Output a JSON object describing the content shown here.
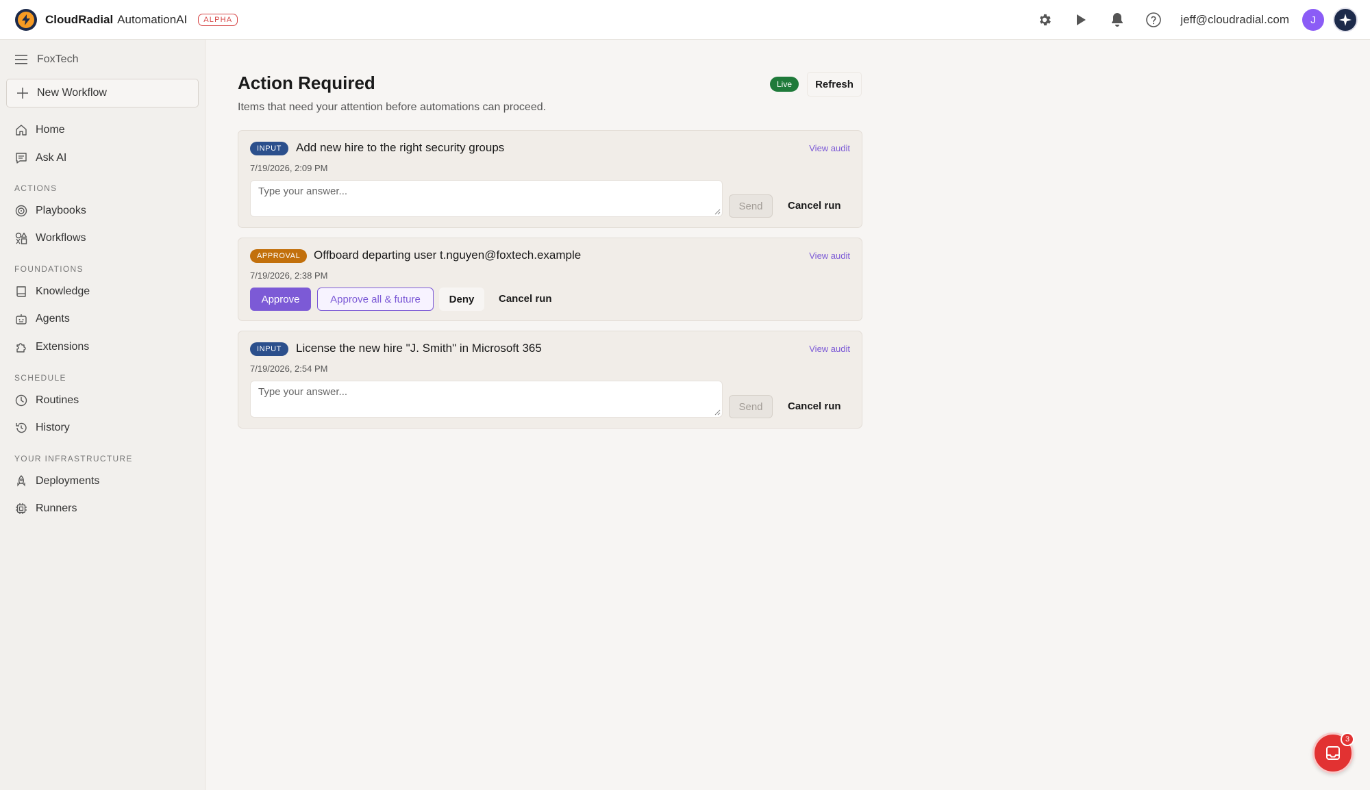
{
  "app": {
    "brand_name": "CloudRadial",
    "product_name": "AutomationAI",
    "stage_badge": "ALPHA"
  },
  "header": {
    "icons": [
      "gear-icon",
      "play-icon",
      "bell-icon",
      "help-icon"
    ],
    "user_email": "jeff@cloudradial.com",
    "avatar_initial": "J"
  },
  "sidebar": {
    "org_name": "FoxTech",
    "new_workflow_label": "New Workflow",
    "items": [
      {
        "label": "Home",
        "icon": "home-icon"
      },
      {
        "label": "Ask AI",
        "icon": "chat-icon"
      }
    ],
    "sections": [
      {
        "title": "ACTIONS",
        "items": [
          {
            "label": "Playbooks",
            "icon": "target-icon"
          },
          {
            "label": "Workflows",
            "icon": "shapes-icon"
          }
        ]
      },
      {
        "title": "FOUNDATIONS",
        "items": [
          {
            "label": "Knowledge",
            "icon": "book-icon"
          },
          {
            "label": "Agents",
            "icon": "robot-icon"
          },
          {
            "label": "Extensions",
            "icon": "puzzle-icon"
          }
        ]
      },
      {
        "title": "SCHEDULE",
        "items": [
          {
            "label": "Routines",
            "icon": "clock-icon"
          },
          {
            "label": "History",
            "icon": "history-icon"
          }
        ]
      },
      {
        "title": "YOUR INFRASTRUCTURE",
        "items": [
          {
            "label": "Deployments",
            "icon": "rocket-icon"
          },
          {
            "label": "Runners",
            "icon": "cpu-icon"
          }
        ]
      }
    ]
  },
  "main": {
    "title": "Action Required",
    "subtitle": "Items that need your attention before automations can proceed.",
    "live_label": "Live",
    "refresh_label": "Refresh",
    "cards": [
      {
        "type": "INPUT",
        "title": "Add new hire to the right security groups",
        "timestamp": "7/19/2026, 2:09 PM",
        "view_audit": "View audit",
        "answer_placeholder": "Type your answer...",
        "send_label": "Send",
        "cancel_label": "Cancel run"
      },
      {
        "type": "APPROVAL",
        "title": "Offboard departing user t.nguyen@foxtech.example",
        "timestamp": "7/19/2026, 2:38 PM",
        "view_audit": "View audit",
        "approve_label": "Approve",
        "approve_all_label": "Approve all & future",
        "deny_label": "Deny",
        "cancel_label": "Cancel run"
      },
      {
        "type": "INPUT",
        "title": "License the new hire \"J. Smith\" in Microsoft 365",
        "timestamp": "7/19/2026, 2:54 PM",
        "view_audit": "View audit",
        "answer_placeholder": "Type your answer...",
        "send_label": "Send",
        "cancel_label": "Cancel run"
      }
    ]
  },
  "chat_widget": {
    "unread_count": "3"
  },
  "colors": {
    "accent": "#7c5ad6",
    "input_badge": "#2b4f8c",
    "approval_badge": "#c2700c",
    "live": "#1f7a3a",
    "chat": "#e23232"
  }
}
